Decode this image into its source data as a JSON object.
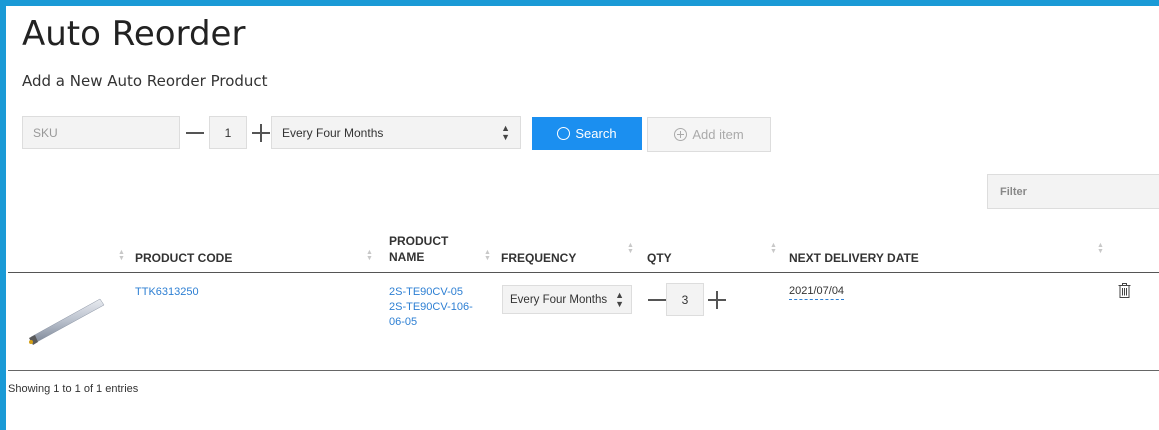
{
  "page": {
    "title": "Auto Reorder",
    "subtitle": "Add a New Auto Reorder Product"
  },
  "add_form": {
    "sku_placeholder": "SKU",
    "qty": "1",
    "frequency_selected": "Every Four Months",
    "search_label": "Search",
    "add_item_label": "Add item"
  },
  "filter": {
    "placeholder": "Filter"
  },
  "table": {
    "columns": [
      "PRODUCT CODE",
      "PRODUCT",
      "NAME",
      "FREQUENCY",
      "QTY",
      "NEXT DELIVERY DATE"
    ],
    "rows": [
      {
        "product_code": "TTK6313250",
        "product_name_lines": [
          "2S-TE90CV-05",
          "2S-TE90CV-106-",
          "06-05"
        ],
        "frequency": "Every Four Months",
        "qty": "3",
        "next_delivery_date": "2021/07/04"
      }
    ],
    "info": "Showing 1 to 1 of 1 entries"
  },
  "colors": {
    "frame": "#1a9ad6",
    "primary_button": "#1b8ff0",
    "link": "#2d7fd3"
  },
  "icons": [
    "search-icon",
    "plus-circle-icon",
    "minus-icon",
    "plus-icon",
    "sort-icon",
    "select-arrows-icon",
    "trash-icon"
  ]
}
